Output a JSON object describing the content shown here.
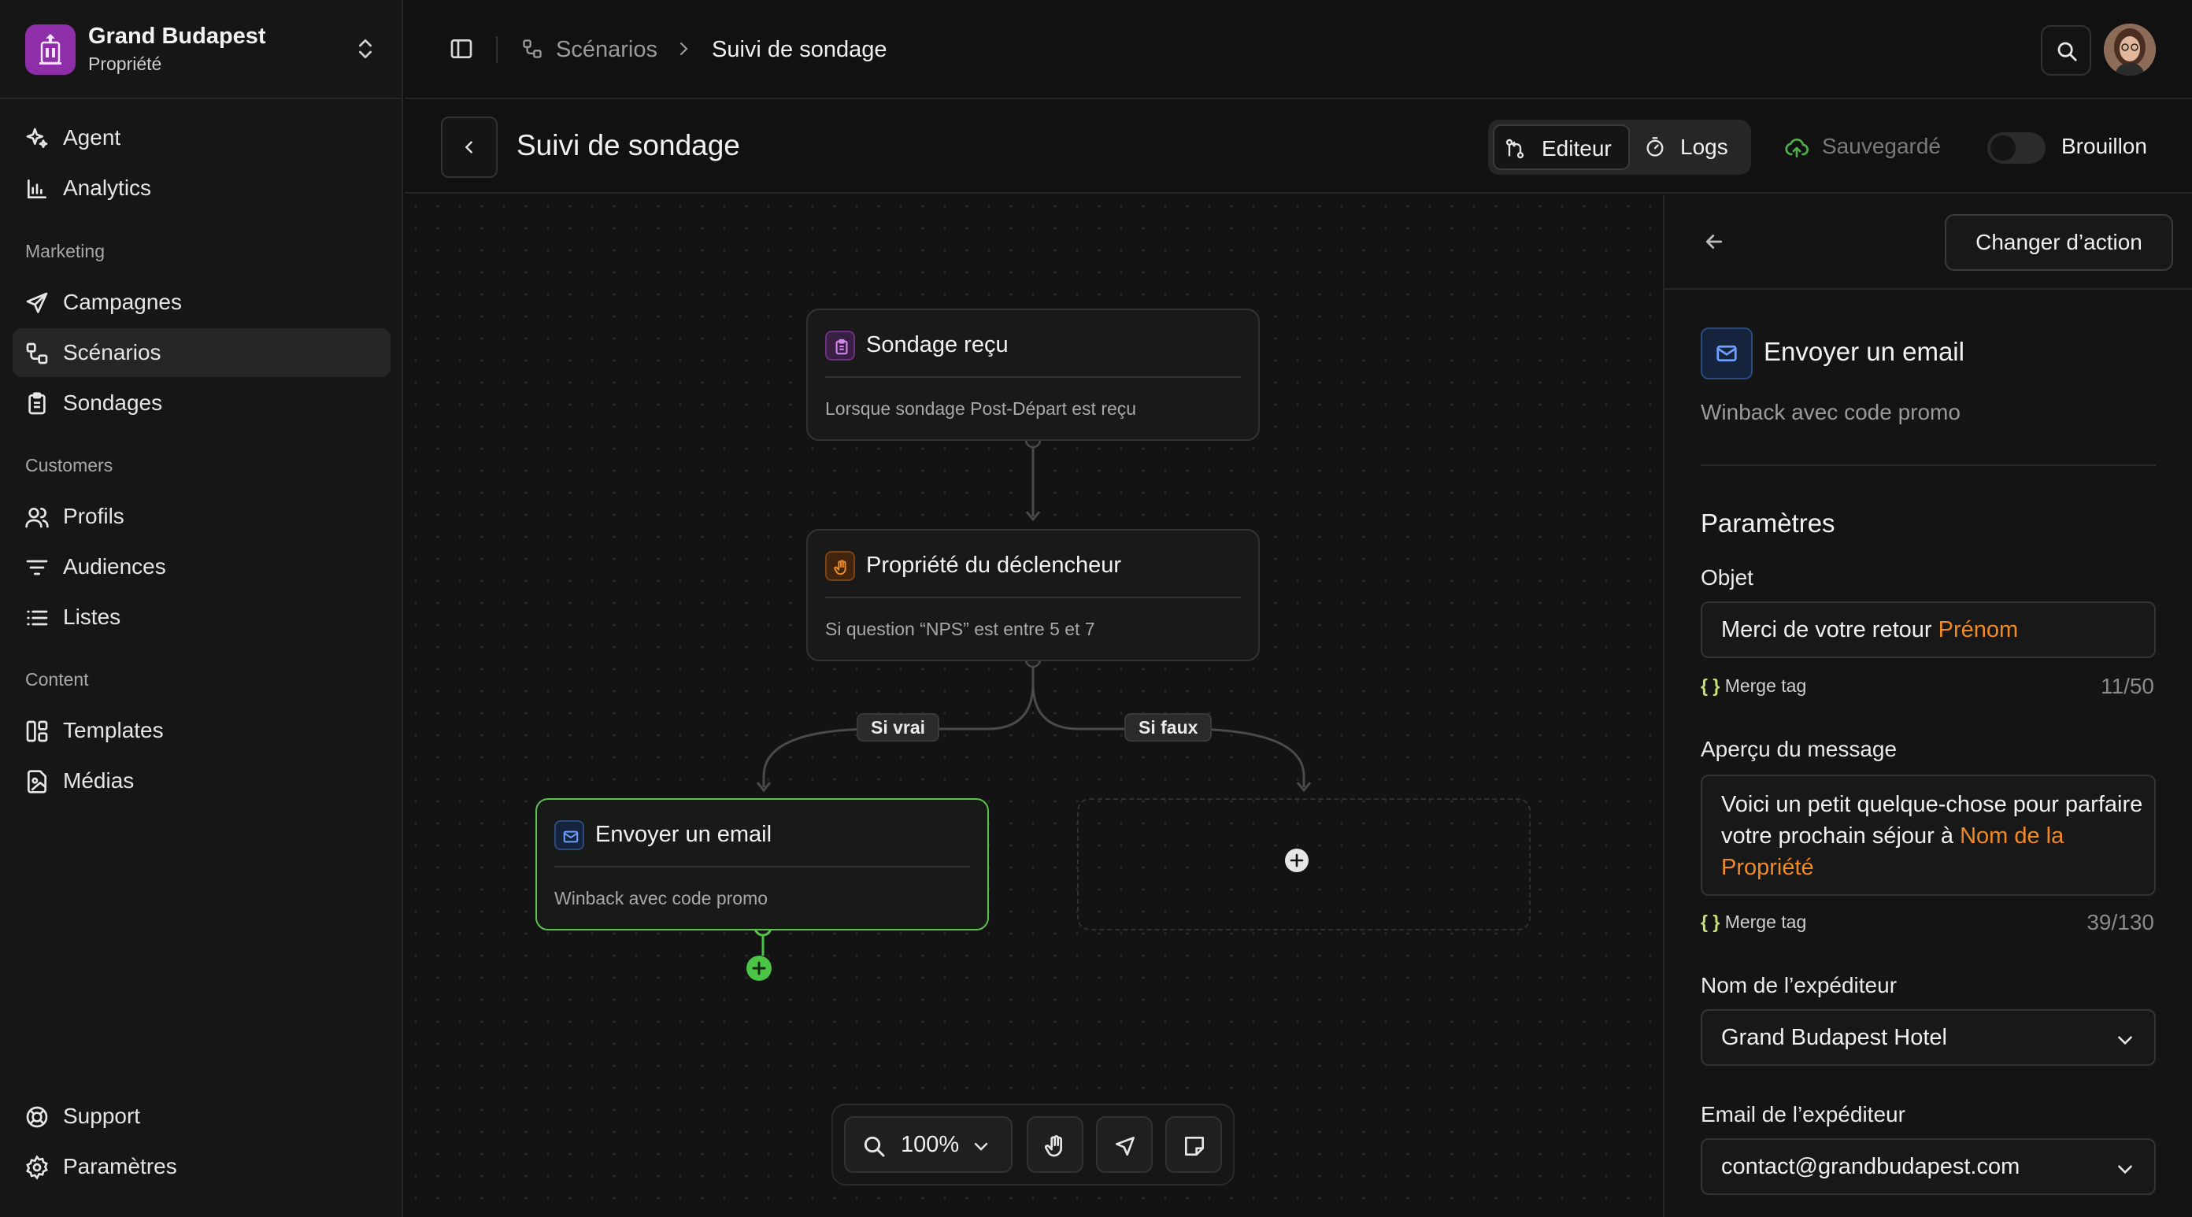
{
  "sidebar": {
    "org_name": "Grand Budapest",
    "org_subtitle": "Propriété",
    "nav": {
      "agent": "Agent",
      "analytics": "Analytics",
      "section_marketing": "Marketing",
      "campagnes": "Campagnes",
      "scenarios": "Scénarios",
      "sondages": "Sondages",
      "section_customers": "Customers",
      "profils": "Profils",
      "audiences": "Audiences",
      "listes": "Listes",
      "section_content": "Content",
      "templates": "Templates",
      "medias": "Médias",
      "support": "Support",
      "parametres": "Paramètres"
    },
    "active_item": "Scénarios"
  },
  "topbar": {
    "breadcrumb": [
      "Scénarios",
      "Suivi de sondage"
    ]
  },
  "page": {
    "title": "Suivi de sondage",
    "tabs": {
      "editor": "Editeur",
      "logs": "Logs"
    },
    "active_tab": "Editeur",
    "save_status": "Sauvegardé",
    "draft_label": "Brouillon",
    "draft_on": false
  },
  "canvas": {
    "nodes": {
      "trigger": {
        "title": "Sondage reçu",
        "desc": "Lorsque sondage Post-Départ est reçu",
        "icon": "clipboard-icon"
      },
      "condition": {
        "title": "Propriété du déclencheur",
        "desc": "Si question “NPS” est entre 5 et 7",
        "icon": "hand-icon"
      },
      "email": {
        "title": "Envoyer un email",
        "desc": "Winback avec code promo",
        "icon": "mail-icon"
      }
    },
    "branches": {
      "true_label": "Si vrai",
      "false_label": "Si faux"
    },
    "zoom": "100%"
  },
  "panel": {
    "change_action": "Changer d’action",
    "action_title": "Envoyer un email",
    "action_desc": "Winback avec code promo",
    "params_title": "Paramètres",
    "subject": {
      "label": "Objet",
      "text": "Merci de votre retour ",
      "tag": "Prénom",
      "merge_tag": "Merge tag",
      "merge_braces": "{ }",
      "counter": "11/50"
    },
    "preview": {
      "label": "Aperçu du message",
      "text": "Voici un petit quelque-chose pour parfaire votre prochain séjour à ",
      "tag": "Nom de la Propriété",
      "merge_tag": "Merge tag",
      "merge_braces": "{ }",
      "counter": "39/130"
    },
    "sender_name": {
      "label": "Nom de l’expéditeur",
      "value": "Grand Budapest Hotel"
    },
    "sender_email": {
      "label": "Email de l’expéditeur",
      "value": "contact@grandbudapest.com"
    }
  },
  "colors": {
    "accent_green": "#5cc24d",
    "merge_tag_orange": "#f08a24",
    "brand_purple": "#8e2ea8"
  }
}
